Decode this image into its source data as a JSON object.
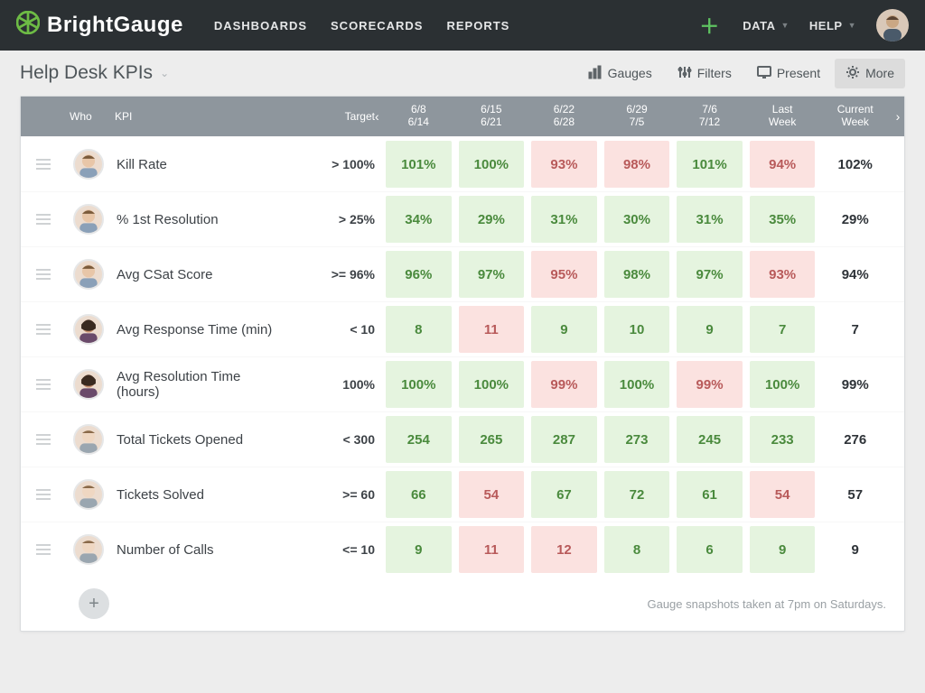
{
  "brand": "BrightGauge",
  "nav": {
    "links": [
      "DASHBOARDS",
      "SCORECARDS",
      "REPORTS"
    ],
    "data": "DATA",
    "help": "HELP"
  },
  "page": {
    "title": "Help Desk KPIs"
  },
  "tools": {
    "gauges": "Gauges",
    "filters": "Filters",
    "present": "Present",
    "more": "More"
  },
  "table": {
    "header": {
      "who": "Who",
      "kpi": "KPI",
      "target": "Target",
      "periods": [
        {
          "l1": "6/8",
          "l2": "6/14"
        },
        {
          "l1": "6/15",
          "l2": "6/21"
        },
        {
          "l1": "6/22",
          "l2": "6/28"
        },
        {
          "l1": "6/29",
          "l2": "7/5"
        },
        {
          "l1": "7/6",
          "l2": "7/12"
        },
        {
          "l1": "Last",
          "l2": "Week"
        },
        {
          "l1": "Current",
          "l2": "Week"
        }
      ]
    },
    "rows": [
      {
        "who": "person-a",
        "kpi": "Kill Rate",
        "target": "> 100%",
        "cells": [
          {
            "v": "101%",
            "s": "good"
          },
          {
            "v": "100%",
            "s": "good"
          },
          {
            "v": "93%",
            "s": "bad"
          },
          {
            "v": "98%",
            "s": "bad"
          },
          {
            "v": "101%",
            "s": "good"
          },
          {
            "v": "94%",
            "s": "bad"
          },
          {
            "v": "102%",
            "s": "plain"
          }
        ]
      },
      {
        "who": "person-a",
        "kpi": "% 1st Resolution",
        "target": "> 25%",
        "cells": [
          {
            "v": "34%",
            "s": "good"
          },
          {
            "v": "29%",
            "s": "good"
          },
          {
            "v": "31%",
            "s": "good"
          },
          {
            "v": "30%",
            "s": "good"
          },
          {
            "v": "31%",
            "s": "good"
          },
          {
            "v": "35%",
            "s": "good"
          },
          {
            "v": "29%",
            "s": "plain"
          }
        ]
      },
      {
        "who": "person-a",
        "kpi": "Avg CSat Score",
        "target": ">= 96%",
        "cells": [
          {
            "v": "96%",
            "s": "good"
          },
          {
            "v": "97%",
            "s": "good"
          },
          {
            "v": "95%",
            "s": "bad"
          },
          {
            "v": "98%",
            "s": "good"
          },
          {
            "v": "97%",
            "s": "good"
          },
          {
            "v": "93%",
            "s": "bad"
          },
          {
            "v": "94%",
            "s": "plain"
          }
        ]
      },
      {
        "who": "person-b",
        "kpi": "Avg Response Time (min)",
        "target": "< 10",
        "cells": [
          {
            "v": "8",
            "s": "good"
          },
          {
            "v": "11",
            "s": "bad"
          },
          {
            "v": "9",
            "s": "good"
          },
          {
            "v": "10",
            "s": "good"
          },
          {
            "v": "9",
            "s": "good"
          },
          {
            "v": "7",
            "s": "good"
          },
          {
            "v": "7",
            "s": "plain"
          }
        ]
      },
      {
        "who": "person-b",
        "kpi": "Avg Resolution Time (hours)",
        "target": "100%",
        "cells": [
          {
            "v": "100%",
            "s": "good"
          },
          {
            "v": "100%",
            "s": "good"
          },
          {
            "v": "99%",
            "s": "bad"
          },
          {
            "v": "100%",
            "s": "good"
          },
          {
            "v": "99%",
            "s": "bad"
          },
          {
            "v": "100%",
            "s": "good"
          },
          {
            "v": "99%",
            "s": "plain"
          }
        ]
      },
      {
        "who": "person-c",
        "kpi": "Total Tickets Opened",
        "target": "< 300",
        "cells": [
          {
            "v": "254",
            "s": "good"
          },
          {
            "v": "265",
            "s": "good"
          },
          {
            "v": "287",
            "s": "good"
          },
          {
            "v": "273",
            "s": "good"
          },
          {
            "v": "245",
            "s": "good"
          },
          {
            "v": "233",
            "s": "good"
          },
          {
            "v": "276",
            "s": "plain"
          }
        ]
      },
      {
        "who": "person-c",
        "kpi": "Tickets Solved",
        "target": ">= 60",
        "cells": [
          {
            "v": "66",
            "s": "good"
          },
          {
            "v": "54",
            "s": "bad"
          },
          {
            "v": "67",
            "s": "good"
          },
          {
            "v": "72",
            "s": "good"
          },
          {
            "v": "61",
            "s": "good"
          },
          {
            "v": "54",
            "s": "bad"
          },
          {
            "v": "57",
            "s": "plain"
          }
        ]
      },
      {
        "who": "person-c",
        "kpi": "Number of Calls",
        "target": "<= 10",
        "cells": [
          {
            "v": "9",
            "s": "good"
          },
          {
            "v": "11",
            "s": "bad"
          },
          {
            "v": "12",
            "s": "bad"
          },
          {
            "v": "8",
            "s": "good"
          },
          {
            "v": "6",
            "s": "good"
          },
          {
            "v": "9",
            "s": "good"
          },
          {
            "v": "9",
            "s": "plain"
          }
        ]
      }
    ],
    "footnote": "Gauge snapshots taken at 7pm on Saturdays."
  },
  "colors": {
    "good_bg": "#e5f4df",
    "bad_bg": "#fbe2e0",
    "accent": "#5ec261"
  }
}
